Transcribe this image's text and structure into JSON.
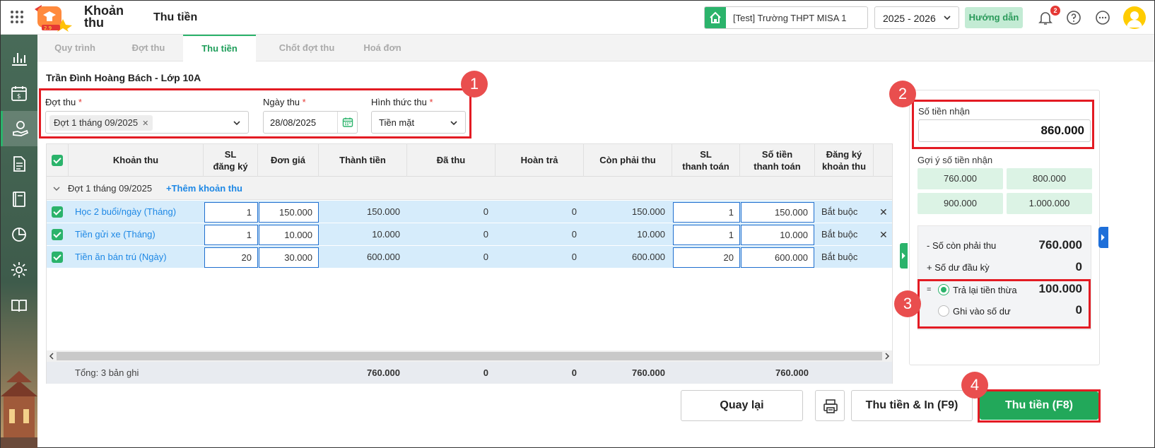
{
  "app": {
    "name_line1": "Khoản",
    "name_line2": "thu",
    "page_title": "Thu tiền"
  },
  "header": {
    "school": "[Test] Trường THPT MISA 1",
    "year": "2025 - 2026",
    "guide_label": "Hướng dẫn",
    "notification_count": "2"
  },
  "tabs": [
    {
      "label": "Quy trình"
    },
    {
      "label": "Đợt thu"
    },
    {
      "label": "Thu tiền",
      "active": true
    },
    {
      "label": "Chốt đợt thu"
    },
    {
      "label": "Hoá đơn"
    }
  ],
  "student": "Trần Đình Hoàng Bách - Lớp 10A",
  "form": {
    "period_label": "Đợt thu",
    "period_value": "Đợt 1 tháng 09/2025",
    "date_label": "Ngày thu",
    "date_value": "28/08/2025",
    "method_label": "Hình thức thu",
    "method_value": "Tiền mặt",
    "required_mark": "*"
  },
  "table": {
    "headers": {
      "fee": "Khoản thu",
      "qty_reg": "SL\nđăng ký",
      "unit_price": "Đơn giá",
      "amount": "Thành tiền",
      "paid": "Đã thu",
      "refund": "Hoàn trả",
      "remaining": "Còn phải thu",
      "qty_pay": "SL\nthanh toán",
      "pay_amount": "Số tiền\nthanh toán",
      "registration": "Đăng ký\nkhoản thu"
    },
    "group_label": "Đợt 1 tháng 09/2025",
    "add_fee_label": "+Thêm khoản thu",
    "rows": [
      {
        "name": "Học 2 buổi/ngày (Tháng)",
        "qty": "1",
        "unit": "150.000",
        "amount": "150.000",
        "paid": "0",
        "refund": "0",
        "remaining": "150.000",
        "qty_pay": "1",
        "pay": "150.000",
        "reg": "Bắt buộc",
        "removable": true
      },
      {
        "name": "Tiền gửi xe (Tháng)",
        "qty": "1",
        "unit": "10.000",
        "amount": "10.000",
        "paid": "0",
        "refund": "0",
        "remaining": "10.000",
        "qty_pay": "1",
        "pay": "10.000",
        "reg": "Bắt buộc",
        "removable": true
      },
      {
        "name": "Tiền ăn bán trú (Ngày)",
        "qty": "20",
        "unit": "30.000",
        "amount": "600.000",
        "paid": "0",
        "refund": "0",
        "remaining": "600.000",
        "qty_pay": "20",
        "pay": "600.000",
        "reg": "Bắt buộc",
        "removable": false
      }
    ],
    "footer": {
      "label": "Tổng: 3 bản ghi",
      "amount": "760.000",
      "paid": "0",
      "refund": "0",
      "remaining": "760.000",
      "pay": "760.000"
    }
  },
  "payment": {
    "received_label": "Số tiền nhận",
    "received_value": "860.000",
    "suggest_label": "Gợi ý số tiền nhận",
    "suggestions": [
      "760.000",
      "800.000",
      "900.000",
      "1.000.000"
    ],
    "remaining_label": "- Số còn phải thu",
    "remaining_value": "760.000",
    "balance_label": "+ Số dư đầu kỳ",
    "balance_value": "0",
    "eq": "=",
    "refund_label": "Trả lại tiền thừa",
    "refund_value": "100.000",
    "save_label": "Ghi vào số dư",
    "save_value": "0"
  },
  "markers": [
    "1",
    "2",
    "3",
    "4"
  ],
  "buttons": {
    "back": "Quay lại",
    "pay_print": "Thu tiền & In (F9)",
    "pay": "Thu tiền (F8)"
  },
  "colors": {
    "accent": "#2bb36b",
    "highlight": "#e31b23",
    "row_selected": "#d6ecfb",
    "link": "#1e88e5"
  }
}
